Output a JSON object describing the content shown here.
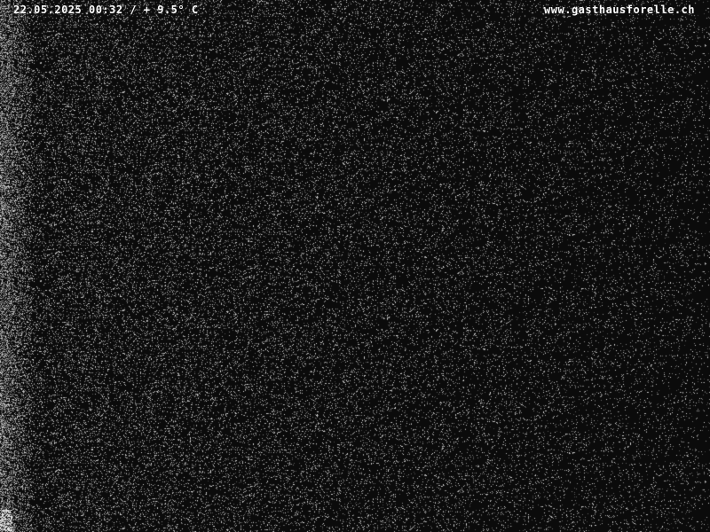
{
  "overlay": {
    "timestamp": "22.05.2025 00:32 / + 9.5° C",
    "site_url": "www.gasthausforelle.ch"
  },
  "colors": {
    "background": "#0b0b0b",
    "noise": "#ffffff",
    "text": "#ffffff"
  }
}
